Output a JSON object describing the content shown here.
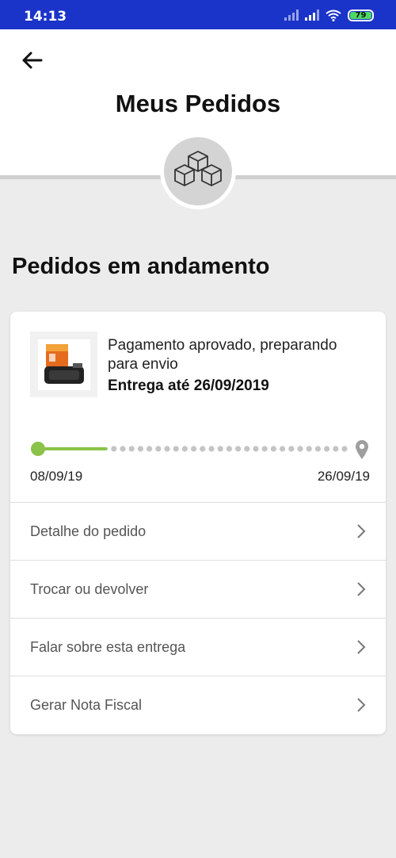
{
  "status_bar": {
    "time": "14:13",
    "battery": "79",
    "background": "#1a33c8"
  },
  "header": {
    "title": "Meus Pedidos",
    "back_icon": "arrow-left-icon",
    "hero_icon": "boxes-icon"
  },
  "section": {
    "title": "Pedidos em andamento"
  },
  "order": {
    "status": "Pagamento aprovado, preparando para envio",
    "delivery": "Entrega até 26/09/2019",
    "start_date": "08/09/19",
    "end_date": "26/09/19",
    "progress_fraction": 0.22,
    "progress_color": "#8bc34a",
    "end_icon": "location-pin-icon"
  },
  "menu": {
    "items": [
      {
        "label": "Detalhe do pedido"
      },
      {
        "label": "Trocar ou devolver"
      },
      {
        "label": "Falar sobre esta entrega"
      },
      {
        "label": "Gerar Nota Fiscal"
      }
    ]
  }
}
